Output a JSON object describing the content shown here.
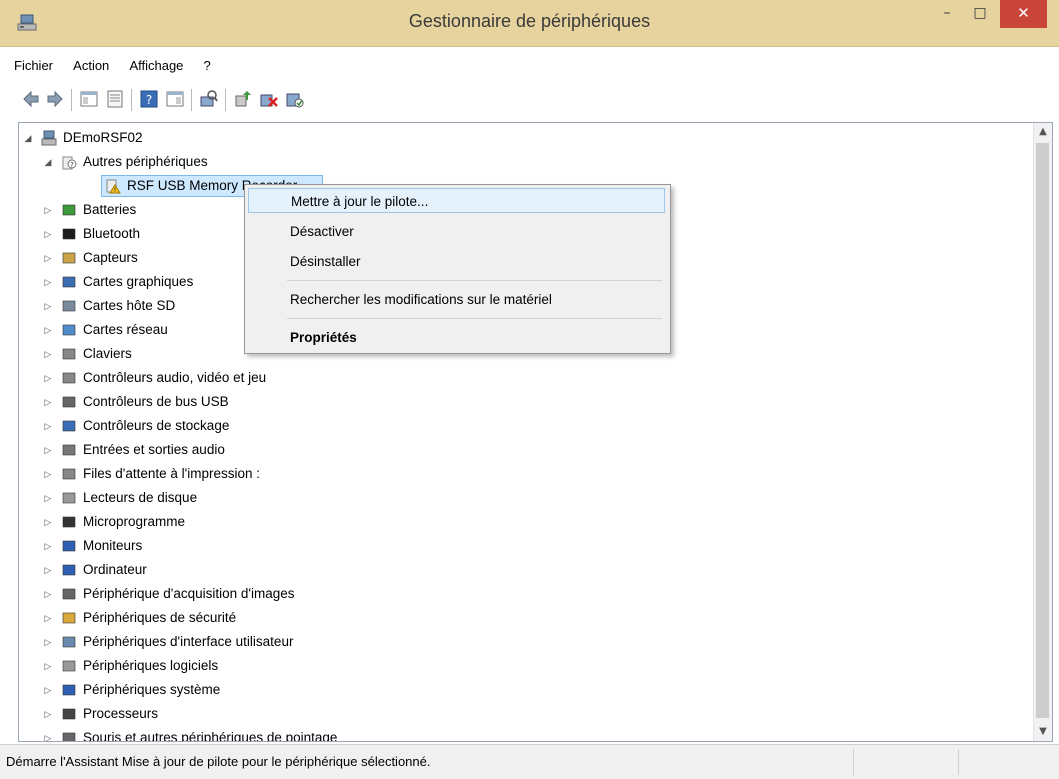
{
  "window": {
    "title": "Gestionnaire de périphériques",
    "min_glyph": "–",
    "max_glyph": "□",
    "close_glyph": "✕"
  },
  "menubar": [
    "Fichier",
    "Action",
    "Affichage",
    "?"
  ],
  "tree": {
    "root": "DEmoRSF02",
    "expanded_category": "Autres périphériques",
    "selected_device": "RSF USB Memory Recorder",
    "categories": [
      "Batteries",
      "Bluetooth",
      "Capteurs",
      "Cartes graphiques",
      "Cartes hôte SD",
      "Cartes réseau",
      "Claviers",
      "Contrôleurs audio, vidéo et jeu",
      "Contrôleurs de bus USB",
      "Contrôleurs de stockage",
      "Entrées et sorties audio",
      "Files d'attente à l'impression :",
      "Lecteurs de disque",
      "Microprogramme",
      "Moniteurs",
      "Ordinateur",
      "Périphérique d'acquisition d'images",
      "Périphériques de sécurité",
      "Périphériques d'interface utilisateur",
      "Périphériques logiciels",
      "Périphériques système",
      "Processeurs",
      "Souris et autres périphériques de pointage"
    ]
  },
  "context_menu": {
    "update_driver": "Mettre à jour le pilote...",
    "disable": "Désactiver",
    "uninstall": "Désinstaller",
    "scan_hardware": "Rechercher les modifications sur le matériel",
    "properties": "Propriétés"
  },
  "statusbar": {
    "text": "Démarre l'Assistant Mise à jour de pilote pour le périphérique sélectionné."
  },
  "colors": {
    "titlebar": "#e7d39e",
    "close_button": "#c9453a",
    "menu_highlight": "#e5f1fb"
  }
}
